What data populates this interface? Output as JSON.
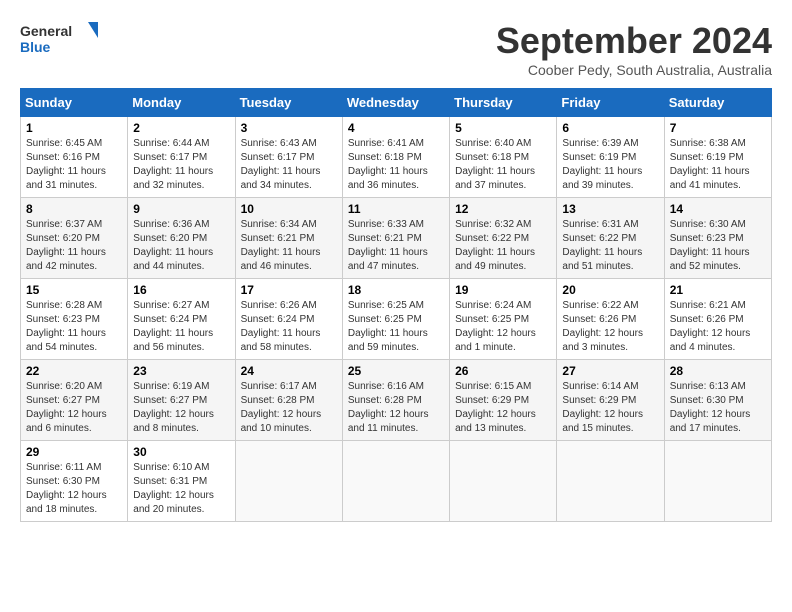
{
  "logo": {
    "line1": "General",
    "line2": "Blue"
  },
  "title": "September 2024",
  "subtitle": "Coober Pedy, South Australia, Australia",
  "days_header": [
    "Sunday",
    "Monday",
    "Tuesday",
    "Wednesday",
    "Thursday",
    "Friday",
    "Saturday"
  ],
  "weeks": [
    [
      {
        "day": "1",
        "sunrise": "6:45 AM",
        "sunset": "6:16 PM",
        "daylight": "11 hours and 31 minutes."
      },
      {
        "day": "2",
        "sunrise": "6:44 AM",
        "sunset": "6:17 PM",
        "daylight": "11 hours and 32 minutes."
      },
      {
        "day": "3",
        "sunrise": "6:43 AM",
        "sunset": "6:17 PM",
        "daylight": "11 hours and 34 minutes."
      },
      {
        "day": "4",
        "sunrise": "6:41 AM",
        "sunset": "6:18 PM",
        "daylight": "11 hours and 36 minutes."
      },
      {
        "day": "5",
        "sunrise": "6:40 AM",
        "sunset": "6:18 PM",
        "daylight": "11 hours and 37 minutes."
      },
      {
        "day": "6",
        "sunrise": "6:39 AM",
        "sunset": "6:19 PM",
        "daylight": "11 hours and 39 minutes."
      },
      {
        "day": "7",
        "sunrise": "6:38 AM",
        "sunset": "6:19 PM",
        "daylight": "11 hours and 41 minutes."
      }
    ],
    [
      {
        "day": "8",
        "sunrise": "6:37 AM",
        "sunset": "6:20 PM",
        "daylight": "11 hours and 42 minutes."
      },
      {
        "day": "9",
        "sunrise": "6:36 AM",
        "sunset": "6:20 PM",
        "daylight": "11 hours and 44 minutes."
      },
      {
        "day": "10",
        "sunrise": "6:34 AM",
        "sunset": "6:21 PM",
        "daylight": "11 hours and 46 minutes."
      },
      {
        "day": "11",
        "sunrise": "6:33 AM",
        "sunset": "6:21 PM",
        "daylight": "11 hours and 47 minutes."
      },
      {
        "day": "12",
        "sunrise": "6:32 AM",
        "sunset": "6:22 PM",
        "daylight": "11 hours and 49 minutes."
      },
      {
        "day": "13",
        "sunrise": "6:31 AM",
        "sunset": "6:22 PM",
        "daylight": "11 hours and 51 minutes."
      },
      {
        "day": "14",
        "sunrise": "6:30 AM",
        "sunset": "6:23 PM",
        "daylight": "11 hours and 52 minutes."
      }
    ],
    [
      {
        "day": "15",
        "sunrise": "6:28 AM",
        "sunset": "6:23 PM",
        "daylight": "11 hours and 54 minutes."
      },
      {
        "day": "16",
        "sunrise": "6:27 AM",
        "sunset": "6:24 PM",
        "daylight": "11 hours and 56 minutes."
      },
      {
        "day": "17",
        "sunrise": "6:26 AM",
        "sunset": "6:24 PM",
        "daylight": "11 hours and 58 minutes."
      },
      {
        "day": "18",
        "sunrise": "6:25 AM",
        "sunset": "6:25 PM",
        "daylight": "11 hours and 59 minutes."
      },
      {
        "day": "19",
        "sunrise": "6:24 AM",
        "sunset": "6:25 PM",
        "daylight": "12 hours and 1 minute."
      },
      {
        "day": "20",
        "sunrise": "6:22 AM",
        "sunset": "6:26 PM",
        "daylight": "12 hours and 3 minutes."
      },
      {
        "day": "21",
        "sunrise": "6:21 AM",
        "sunset": "6:26 PM",
        "daylight": "12 hours and 4 minutes."
      }
    ],
    [
      {
        "day": "22",
        "sunrise": "6:20 AM",
        "sunset": "6:27 PM",
        "daylight": "12 hours and 6 minutes."
      },
      {
        "day": "23",
        "sunrise": "6:19 AM",
        "sunset": "6:27 PM",
        "daylight": "12 hours and 8 minutes."
      },
      {
        "day": "24",
        "sunrise": "6:17 AM",
        "sunset": "6:28 PM",
        "daylight": "12 hours and 10 minutes."
      },
      {
        "day": "25",
        "sunrise": "6:16 AM",
        "sunset": "6:28 PM",
        "daylight": "12 hours and 11 minutes."
      },
      {
        "day": "26",
        "sunrise": "6:15 AM",
        "sunset": "6:29 PM",
        "daylight": "12 hours and 13 minutes."
      },
      {
        "day": "27",
        "sunrise": "6:14 AM",
        "sunset": "6:29 PM",
        "daylight": "12 hours and 15 minutes."
      },
      {
        "day": "28",
        "sunrise": "6:13 AM",
        "sunset": "6:30 PM",
        "daylight": "12 hours and 17 minutes."
      }
    ],
    [
      {
        "day": "29",
        "sunrise": "6:11 AM",
        "sunset": "6:30 PM",
        "daylight": "12 hours and 18 minutes."
      },
      {
        "day": "30",
        "sunrise": "6:10 AM",
        "sunset": "6:31 PM",
        "daylight": "12 hours and 20 minutes."
      },
      null,
      null,
      null,
      null,
      null
    ]
  ],
  "labels": {
    "sunrise": "Sunrise:",
    "sunset": "Sunset:",
    "daylight": "Daylight:"
  }
}
